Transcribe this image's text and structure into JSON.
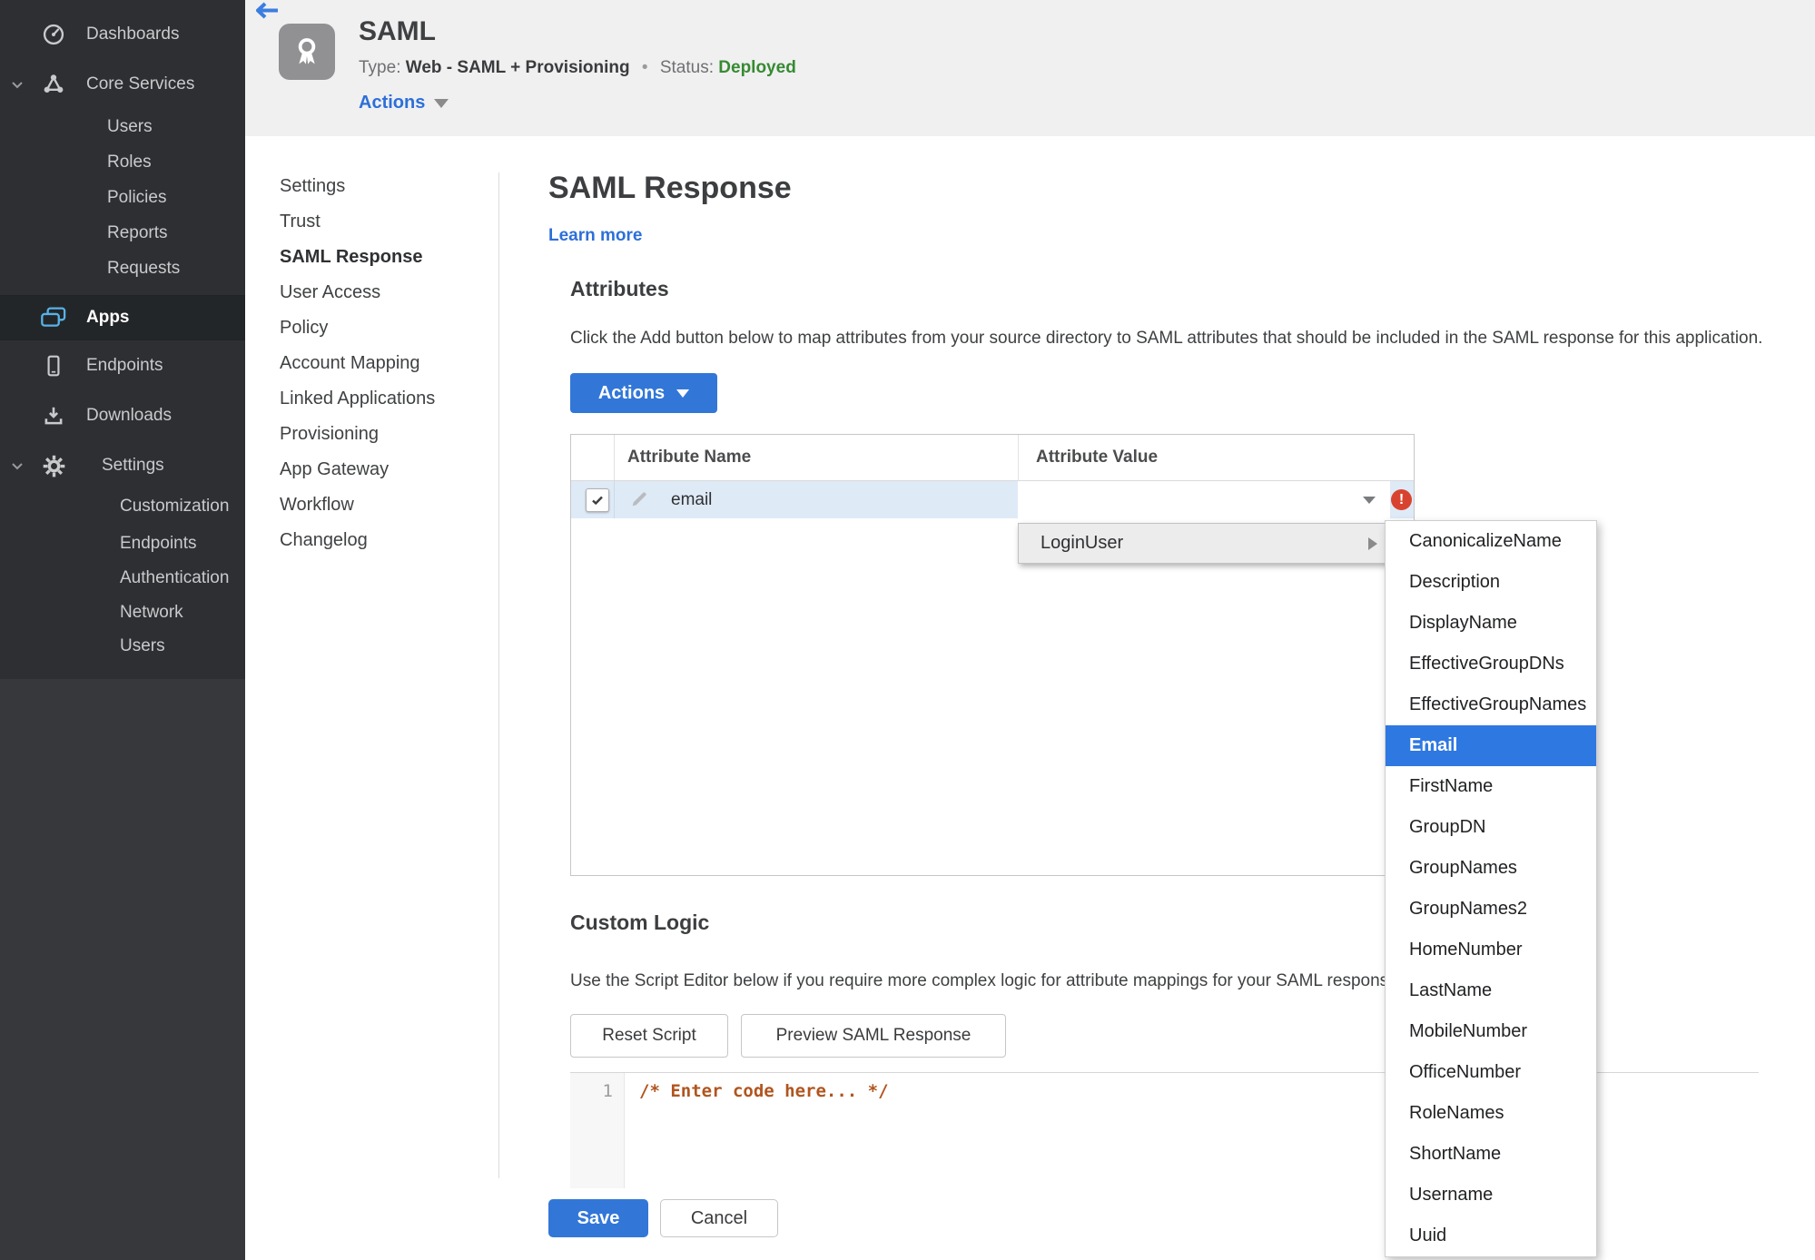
{
  "colors": {
    "accent_blue": "#3277d8",
    "link_blue": "#2d6fd9",
    "selection_blue": "#2e78e2",
    "row_highlight": "#dfeaf7",
    "status_green": "#378a32",
    "error_red": "#d8432f",
    "code_orange": "#b0551f",
    "sidebar_bg": "#2d2f32",
    "apps_icon_cyan": "#58b2e8"
  },
  "sidebar": {
    "items": [
      {
        "label": "Dashboards",
        "icon": "gauge-icon"
      },
      {
        "label": "Core Services",
        "icon": "hub-icon"
      },
      {
        "label": "Users"
      },
      {
        "label": "Roles"
      },
      {
        "label": "Policies"
      },
      {
        "label": "Reports"
      },
      {
        "label": "Requests"
      },
      {
        "label": "Apps",
        "icon": "apps-icon",
        "active": true
      },
      {
        "label": "Endpoints",
        "icon": "device-icon"
      },
      {
        "label": "Downloads",
        "icon": "download-icon"
      },
      {
        "label": "Settings",
        "icon": "gear-icon"
      },
      {
        "label": "Customization"
      },
      {
        "label": "Endpoints"
      },
      {
        "label": "Authentication"
      },
      {
        "label": "Network"
      },
      {
        "label": "Users"
      }
    ]
  },
  "header": {
    "title": "SAML",
    "type_label": "Type:",
    "type_value": "Web - SAML + Provisioning",
    "separator": "•",
    "status_label": "Status:",
    "status_value": "Deployed",
    "actions_label": "Actions",
    "app_icon": "award-ribbon-icon",
    "back_icon": "back-arrow-icon"
  },
  "subnav": {
    "items": [
      {
        "label": "Settings"
      },
      {
        "label": "Trust"
      },
      {
        "label": "SAML Response",
        "active": true
      },
      {
        "label": "User Access"
      },
      {
        "label": "Policy"
      },
      {
        "label": "Account Mapping"
      },
      {
        "label": "Linked Applications"
      },
      {
        "label": "Provisioning"
      },
      {
        "label": "App Gateway"
      },
      {
        "label": "Workflow"
      },
      {
        "label": "Changelog"
      }
    ]
  },
  "main": {
    "title": "SAML Response",
    "learn_more": "Learn more",
    "attributes": {
      "heading": "Attributes",
      "description": "Click the Add button below to map attributes from your source directory to SAML attributes that should be included in the SAML response for this application.",
      "actions_button": "Actions",
      "table": {
        "col_name": "Attribute Name",
        "col_value": "Attribute Value",
        "row": {
          "name": "email",
          "checked": true,
          "value": "",
          "error": "!"
        }
      }
    },
    "custom_logic": {
      "heading": "Custom Logic",
      "description": "Use the Script Editor below if you require more complex logic for attribute mappings for your SAML response.",
      "reset_button": "Reset Script",
      "preview_button": "Preview SAML Response",
      "editor": {
        "line_number": "1",
        "code": "/* Enter code here... */"
      }
    },
    "save_button": "Save",
    "cancel_button": "Cancel"
  },
  "dropdown": {
    "parent_item": "LoginUser",
    "selected": "Email",
    "items": [
      "CanonicalizeName",
      "Description",
      "DisplayName",
      "EffectiveGroupDNs",
      "EffectiveGroupNames",
      "Email",
      "FirstName",
      "GroupDN",
      "GroupNames",
      "GroupNames2",
      "HomeNumber",
      "LastName",
      "MobileNumber",
      "OfficeNumber",
      "RoleNames",
      "ShortName",
      "Username",
      "Uuid"
    ]
  }
}
